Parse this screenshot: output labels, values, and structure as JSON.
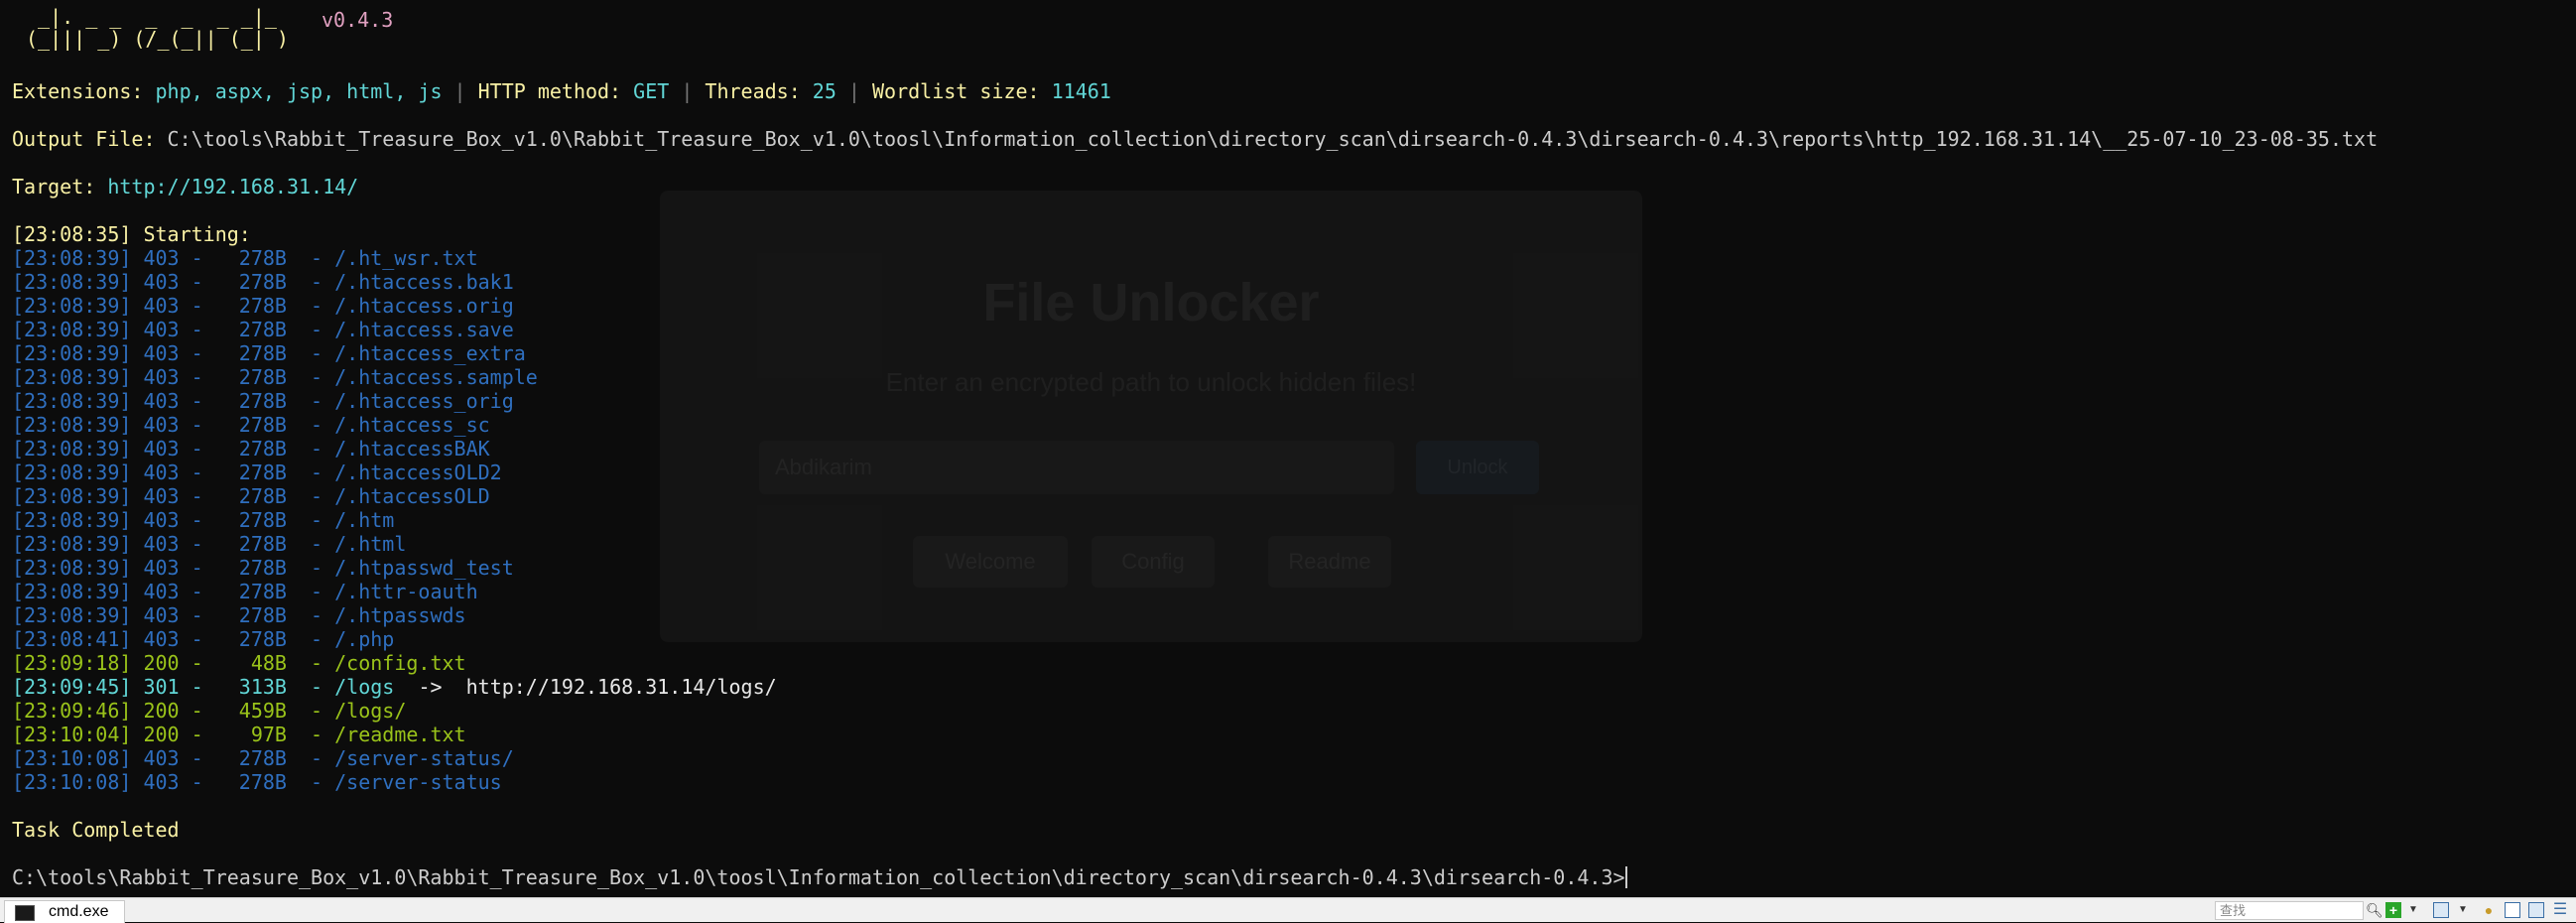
{
  "banner": {
    "art_line1": " _|. _ _  _  _  _ _|_ ",
    "art_line2": "(_||| _) (/_(_|| (_| )",
    "version": "v0.4.3"
  },
  "config": {
    "extensions_label": "Extensions: ",
    "extensions_value": "php, aspx, jsp, html, js",
    "separator": " | ",
    "method_label": "HTTP method: ",
    "method_value": "GET",
    "threads_label": "Threads: ",
    "threads_value": "25",
    "wordlist_label": "Wordlist size: ",
    "wordlist_value": "11461"
  },
  "output": {
    "label": "Output File: ",
    "path": "C:\\tools\\Rabbit_Treasure_Box_v1.0\\Rabbit_Treasure_Box_v1.0\\toosl\\Information_collection\\directory_scan\\dirsearch-0.4.3\\dirsearch-0.4.3\\reports\\http_192.168.31.14\\__25-07-10_23-08-35.txt"
  },
  "target": {
    "label": "Target: ",
    "url": "http://192.168.31.14/"
  },
  "starting": "[23:08:35] Starting:",
  "results": [
    {
      "time": "[23:08:39]",
      "code": "403",
      "size": "  278B",
      "path": "/.ht_wsr.txt",
      "color": "#2f6fbf"
    },
    {
      "time": "[23:08:39]",
      "code": "403",
      "size": "  278B",
      "path": "/.htaccess.bak1",
      "color": "#2f6fbf"
    },
    {
      "time": "[23:08:39]",
      "code": "403",
      "size": "  278B",
      "path": "/.htaccess.orig",
      "color": "#2f6fbf"
    },
    {
      "time": "[23:08:39]",
      "code": "403",
      "size": "  278B",
      "path": "/.htaccess.save",
      "color": "#2f6fbf"
    },
    {
      "time": "[23:08:39]",
      "code": "403",
      "size": "  278B",
      "path": "/.htaccess_extra",
      "color": "#2f6fbf"
    },
    {
      "time": "[23:08:39]",
      "code": "403",
      "size": "  278B",
      "path": "/.htaccess.sample",
      "color": "#2f6fbf"
    },
    {
      "time": "[23:08:39]",
      "code": "403",
      "size": "  278B",
      "path": "/.htaccess_orig",
      "color": "#2f6fbf"
    },
    {
      "time": "[23:08:39]",
      "code": "403",
      "size": "  278B",
      "path": "/.htaccess_sc",
      "color": "#2f6fbf"
    },
    {
      "time": "[23:08:39]",
      "code": "403",
      "size": "  278B",
      "path": "/.htaccessBAK",
      "color": "#2f6fbf"
    },
    {
      "time": "[23:08:39]",
      "code": "403",
      "size": "  278B",
      "path": "/.htaccessOLD2",
      "color": "#2f6fbf"
    },
    {
      "time": "[23:08:39]",
      "code": "403",
      "size": "  278B",
      "path": "/.htaccessOLD",
      "color": "#2f6fbf"
    },
    {
      "time": "[23:08:39]",
      "code": "403",
      "size": "  278B",
      "path": "/.htm",
      "color": "#2f6fbf"
    },
    {
      "time": "[23:08:39]",
      "code": "403",
      "size": "  278B",
      "path": "/.html",
      "color": "#2f6fbf"
    },
    {
      "time": "[23:08:39]",
      "code": "403",
      "size": "  278B",
      "path": "/.htpasswd_test",
      "color": "#2f6fbf"
    },
    {
      "time": "[23:08:39]",
      "code": "403",
      "size": "  278B",
      "path": "/.httr-oauth",
      "color": "#2f6fbf"
    },
    {
      "time": "[23:08:39]",
      "code": "403",
      "size": "  278B",
      "path": "/.htpasswds",
      "color": "#2f6fbf"
    },
    {
      "time": "[23:08:41]",
      "code": "403",
      "size": "  278B",
      "path": "/.php",
      "color": "#2f6fbf"
    },
    {
      "time": "[23:09:18]",
      "code": "200",
      "size": "   48B",
      "path": "/config.txt",
      "color": "#9ac31a"
    },
    {
      "time": "[23:09:45]",
      "code": "301",
      "size": "  313B",
      "path": "/logs",
      "color": "#61d6d6",
      "redirect": "  ->  http://192.168.31.14/logs/"
    },
    {
      "time": "[23:09:46]",
      "code": "200",
      "size": "  459B",
      "path": "/logs/",
      "color": "#9ac31a"
    },
    {
      "time": "[23:10:04]",
      "code": "200",
      "size": "   97B",
      "path": "/readme.txt",
      "color": "#9ac31a"
    },
    {
      "time": "[23:10:08]",
      "code": "403",
      "size": "  278B",
      "path": "/server-status/",
      "color": "#2f6fbf"
    },
    {
      "time": "[23:10:08]",
      "code": "403",
      "size": "  278B",
      "path": "/server-status",
      "color": "#2f6fbf"
    }
  ],
  "task_completed": "Task Completed",
  "prompt": "C:\\tools\\Rabbit_Treasure_Box_v1.0\\Rabbit_Treasure_Box_v1.0\\toosl\\Information_collection\\directory_scan\\dirsearch-0.4.3\\dirsearch-0.4.3>",
  "background_app": {
    "title": "File Unlocker",
    "subtitle": "Enter an encrypted path to unlock hidden files!",
    "input_placeholder": "Abdikarim",
    "button": "Unlock",
    "tabs": [
      "Welcome",
      "Config",
      "Readme"
    ]
  },
  "taskbar": {
    "app_label": "cmd.exe",
    "search_placeholder": "查找",
    "icons": [
      "search-icon",
      "add-icon",
      "dropdown-icon",
      "window-icon",
      "dropdown-icon",
      "lock-icon",
      "panel-icon",
      "menu-icon"
    ]
  }
}
